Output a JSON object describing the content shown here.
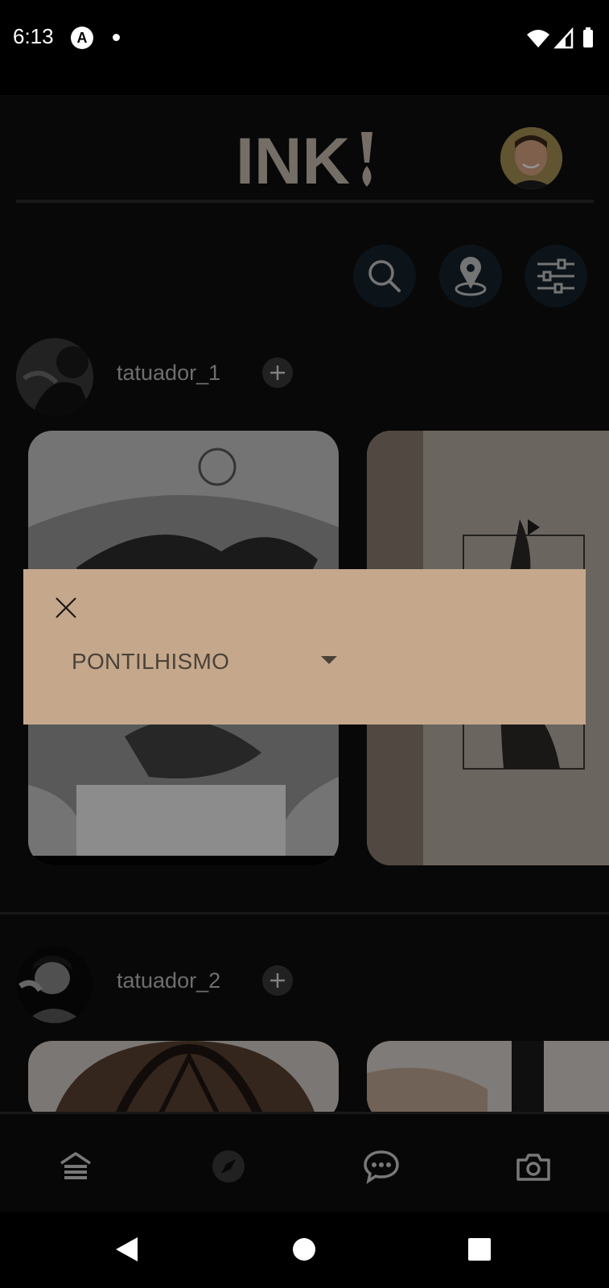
{
  "status_bar": {
    "time": "6:13",
    "notification_icon": "A"
  },
  "header": {
    "logo_text": "INK"
  },
  "toolbar": {
    "icons": [
      "search-icon",
      "location-pin-icon",
      "filter-sliders-icon"
    ]
  },
  "feed": {
    "artists": [
      {
        "name": "tatuador_1"
      },
      {
        "name": "tatuador_2"
      }
    ]
  },
  "bottom_nav": {
    "items": [
      "home-icon",
      "explore-compass-icon",
      "chat-icon",
      "camera-icon"
    ]
  },
  "filter_dialog": {
    "selected_style": "PONTILHISMO"
  },
  "colors": {
    "dialog_bg": "#c5a88c",
    "logo": "#c9beb0",
    "button_bg": "#16222c"
  }
}
